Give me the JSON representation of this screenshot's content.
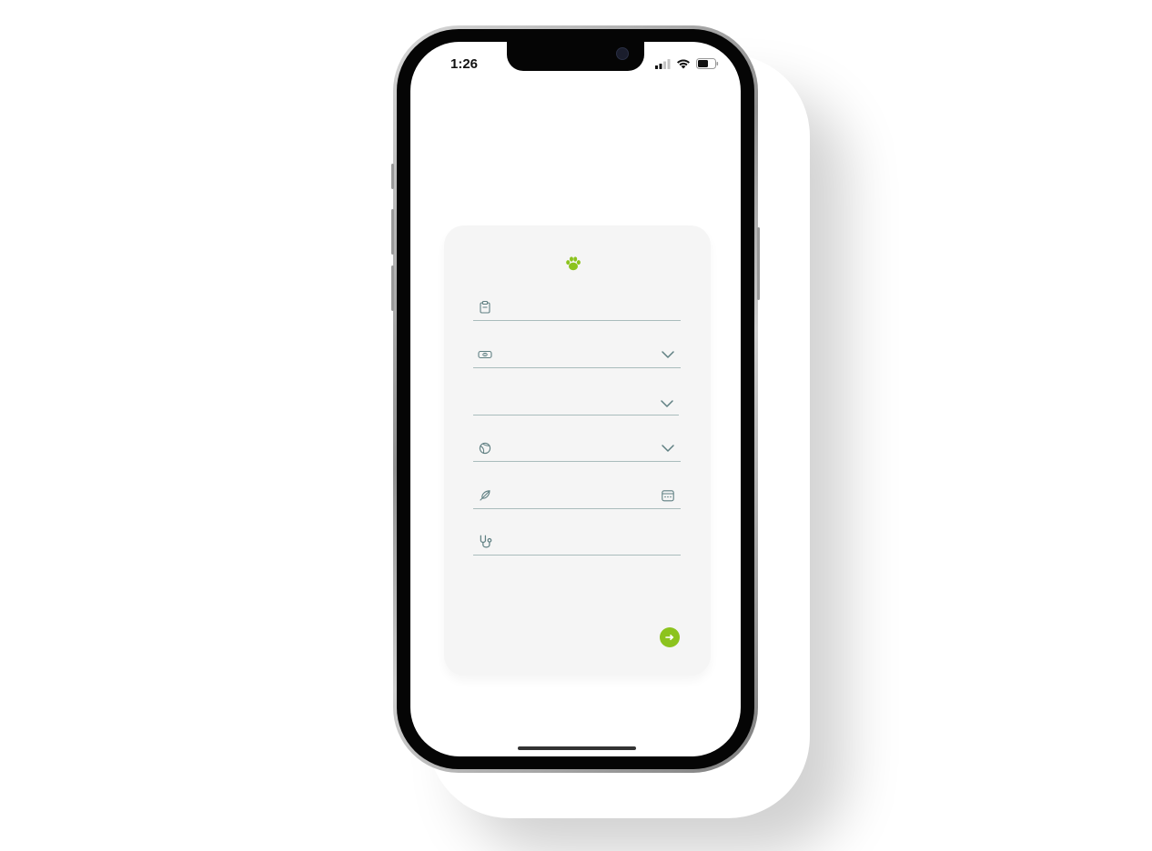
{
  "status_bar": {
    "time": "1:26",
    "icons": [
      "cellular-signal-icon",
      "wifi-icon",
      "battery-icon"
    ]
  },
  "form": {
    "logo_icon": "paw-icon",
    "fields": [
      {
        "name": "name-field",
        "icon": "clipboard-icon",
        "value": "",
        "has_dropdown": false
      },
      {
        "name": "species-field",
        "icon": "pet-carrier-icon",
        "value": "",
        "has_dropdown": true
      },
      {
        "name": "breed-field",
        "icon": "",
        "value": "",
        "has_dropdown": true
      },
      {
        "name": "gender-field",
        "icon": "ball-icon",
        "value": "",
        "has_dropdown": true
      },
      {
        "name": "birthdate-field",
        "icon": "feather-icon",
        "value": "",
        "trailing_icon": "calendar-icon"
      },
      {
        "name": "vet-field",
        "icon": "stethoscope-icon",
        "value": "",
        "has_dropdown": false
      }
    ],
    "next_button_icon": "arrow-right-icon"
  },
  "colors": {
    "accent": "#8cc31e",
    "field_icon": "#5f7f82",
    "underline": "#a9bcbc",
    "card_bg": "#f5f5f5"
  }
}
